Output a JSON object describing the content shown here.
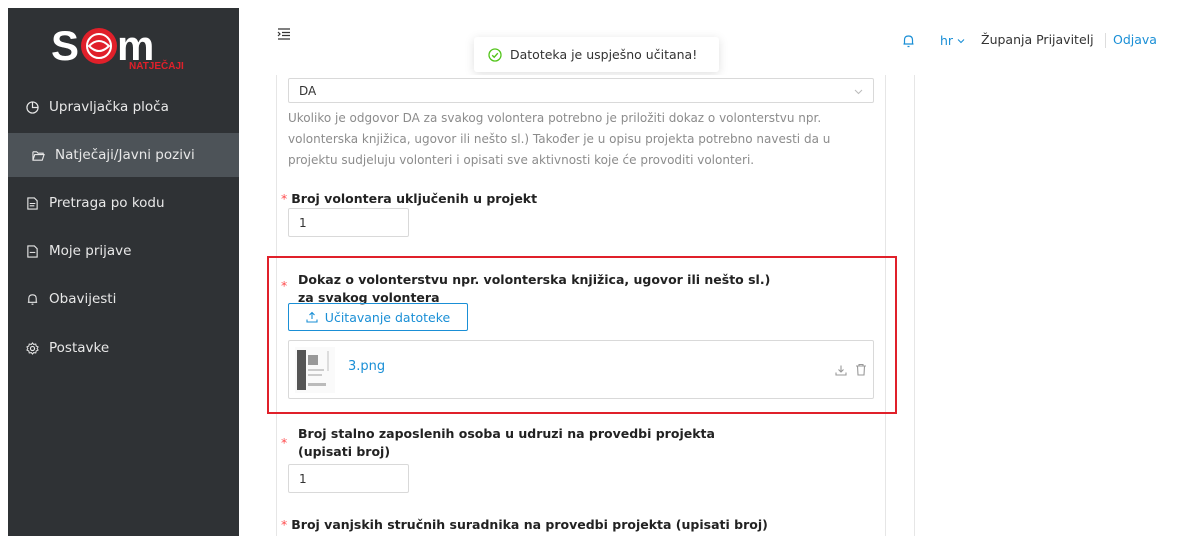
{
  "brand": {
    "logo_text": "SOM",
    "logo_sub": "NATJEČAJI",
    "accent": "#e0202a"
  },
  "sidebar": {
    "items": [
      {
        "label": "Upravljačka ploča",
        "icon": "dashboard-icon",
        "active": false
      },
      {
        "label": "Natječaji/Javni pozivi",
        "icon": "folder-open-icon",
        "active": true
      },
      {
        "label": "Pretraga po kodu",
        "icon": "file-search-icon",
        "active": false
      },
      {
        "label": "Moje prijave",
        "icon": "file-icon",
        "active": false
      },
      {
        "label": "Obavijesti",
        "icon": "bell-icon",
        "active": false
      },
      {
        "label": "Postavke",
        "icon": "gear-icon",
        "active": false
      }
    ]
  },
  "header": {
    "toast_message": "Datoteka je uspješno učitana!",
    "lang": "hr",
    "user_name": "Županja Prijavitelj",
    "logout_label": "Odjava"
  },
  "form": {
    "select_value": "DA",
    "help_text": "Ukoliko je odgovor DA za svakog volontera potrebno je priložiti dokaz o volonterstvu npr. volonterska knjižica, ugovor ili nešto sl.) Također je u opisu projekta potrebno navesti da u projektu sudjeluju volonteri i opisati sve aktivnosti koje će provoditi volonteri.",
    "field_volunteers": {
      "label": "Broj volontera uključenih u projekt",
      "value": "1"
    },
    "field_proof": {
      "label": "Dokaz o volonterstvu npr. volonterska knjižica, ugovor ili nešto sl.) za svakog volontera",
      "upload_label": "Učitavanje datoteke",
      "file_name": "3.png"
    },
    "field_employees": {
      "label": "Broj stalno zaposlenih osoba u udruzi na provedbi projekta (upisati broj)",
      "value": "1"
    },
    "field_external": {
      "label": "Broj vanjskih stručnih suradnika na provedbi projekta (upisati broj)"
    }
  },
  "colors": {
    "link": "#1a8fd6",
    "sidebar_bg": "#2f3235",
    "sidebar_active": "#4d5358",
    "required": "#ff4d4f"
  }
}
